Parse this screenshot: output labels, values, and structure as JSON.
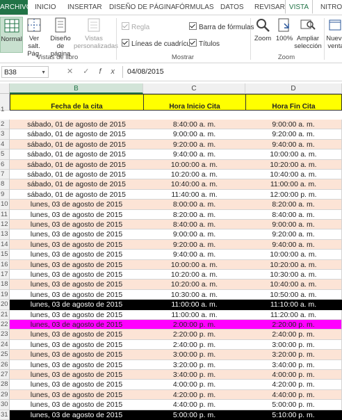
{
  "ribbon_tabs": [
    "ARCHIVO",
    "INICIO",
    "INSERTAR",
    "DISEÑO DE PÁGINA",
    "FÓRMULAS",
    "DATOS",
    "REVISAR",
    "VISTA",
    "NITRO P"
  ],
  "ribbon": {
    "normal": "Normal",
    "page_break": "Ver salt. Pág.",
    "page_layout": "Diseño de página",
    "custom_views": "Vistas personalizadas",
    "group_workbook_views": "Vistas de libro",
    "ruler": "Regla",
    "gridlines": "Líneas de cuadrícula",
    "formula_bar": "Barra de fórmulas",
    "headings": "Títulos",
    "group_show": "Mostrar",
    "zoom": "Zoom",
    "zoom_100": "100%",
    "zoom_selection": "Ampliar selección",
    "group_zoom": "Zoom",
    "new_window": "Nueva venta"
  },
  "formula_bar": {
    "name_box": "B38",
    "content": "04/08/2015"
  },
  "columns": [
    "B",
    "C",
    "D"
  ],
  "headers": [
    "Fecha de la cita",
    "Hora Inicio Cita",
    "Hora Fin Cita"
  ],
  "rows": [
    {
      "n": "2",
      "date": "sábado, 01 de agosto de 2015",
      "start": "8:40:00 a. m.",
      "end": "9:00:00 a. m.",
      "style": "peach"
    },
    {
      "n": "3",
      "date": "sábado, 01 de agosto de 2015",
      "start": "9:00:00 a. m.",
      "end": "9:20:00 a. m.",
      "style": "white"
    },
    {
      "n": "4",
      "date": "sábado, 01 de agosto de 2015",
      "start": "9:20:00 a. m.",
      "end": "9:40:00 a. m.",
      "style": "peach"
    },
    {
      "n": "5",
      "date": "sábado, 01 de agosto de 2015",
      "start": "9:40:00 a. m.",
      "end": "10:00:00 a. m.",
      "style": "white"
    },
    {
      "n": "6",
      "date": "sábado, 01 de agosto de 2015",
      "start": "10:00:00 a. m.",
      "end": "10:20:00 a. m.",
      "style": "peach"
    },
    {
      "n": "7",
      "date": "sábado, 01 de agosto de 2015",
      "start": "10:20:00 a. m.",
      "end": "10:40:00 a. m.",
      "style": "white"
    },
    {
      "n": "8",
      "date": "sábado, 01 de agosto de 2015",
      "start": "10:40:00 a. m.",
      "end": "11:00:00 a. m.",
      "style": "peach"
    },
    {
      "n": "9",
      "date": "sábado, 01 de agosto de 2015",
      "start": "11:40:00 a. m.",
      "end": "12:00:00 p. m.",
      "style": "white"
    },
    {
      "n": "10",
      "date": "lunes, 03 de agosto de 2015",
      "start": "8:00:00 a. m.",
      "end": "8:20:00 a. m.",
      "style": "peach"
    },
    {
      "n": "11",
      "date": "lunes, 03 de agosto de 2015",
      "start": "8:20:00 a. m.",
      "end": "8:40:00 a. m.",
      "style": "white"
    },
    {
      "n": "12",
      "date": "lunes, 03 de agosto de 2015",
      "start": "8:40:00 a. m.",
      "end": "9:00:00 a. m.",
      "style": "peach"
    },
    {
      "n": "13",
      "date": "lunes, 03 de agosto de 2015",
      "start": "9:00:00 a. m.",
      "end": "9:20:00 a. m.",
      "style": "white"
    },
    {
      "n": "14",
      "date": "lunes, 03 de agosto de 2015",
      "start": "9:20:00 a. m.",
      "end": "9:40:00 a. m.",
      "style": "peach"
    },
    {
      "n": "15",
      "date": "lunes, 03 de agosto de 2015",
      "start": "9:40:00 a. m.",
      "end": "10:00:00 a. m.",
      "style": "white"
    },
    {
      "n": "16",
      "date": "lunes, 03 de agosto de 2015",
      "start": "10:00:00 a. m.",
      "end": "10:20:00 a. m.",
      "style": "peach"
    },
    {
      "n": "17",
      "date": "lunes, 03 de agosto de 2015",
      "start": "10:20:00 a. m.",
      "end": "10:30:00 a. m.",
      "style": "white"
    },
    {
      "n": "18",
      "date": "lunes, 03 de agosto de 2015",
      "start": "10:20:00 a. m.",
      "end": "10:40:00 a. m.",
      "style": "peach"
    },
    {
      "n": "19",
      "date": "lunes, 03 de agosto de 2015",
      "start": "10:30:00 a. m.",
      "end": "10:50:00 a. m.",
      "style": "white"
    },
    {
      "n": "20",
      "date": "lunes, 03 de agosto de 2015",
      "start": "11:00:00 a. m.",
      "end": "11:10:00 a. m.",
      "style": "black"
    },
    {
      "n": "21",
      "date": "lunes, 03 de agosto de 2015",
      "start": "11:00:00 a. m.",
      "end": "11:20:00 a. m.",
      "style": "white"
    },
    {
      "n": "22",
      "date": "lunes, 03 de agosto de 2015",
      "start": "2:00:00 p. m.",
      "end": "2:20:00 p. m.",
      "style": "magenta"
    },
    {
      "n": "23",
      "date": "lunes, 03 de agosto de 2015",
      "start": "2:20:00 p. m.",
      "end": "2:40:00 p. m.",
      "style": "peach"
    },
    {
      "n": "24",
      "date": "lunes, 03 de agosto de 2015",
      "start": "2:40:00 p. m.",
      "end": "3:00:00 p. m.",
      "style": "white"
    },
    {
      "n": "25",
      "date": "lunes, 03 de agosto de 2015",
      "start": "3:00:00 p. m.",
      "end": "3:20:00 p. m.",
      "style": "peach"
    },
    {
      "n": "26",
      "date": "lunes, 03 de agosto de 2015",
      "start": "3:20:00 p. m.",
      "end": "3:40:00 p. m.",
      "style": "white"
    },
    {
      "n": "27",
      "date": "lunes, 03 de agosto de 2015",
      "start": "3:40:00 p. m.",
      "end": "4:00:00 p. m.",
      "style": "peach"
    },
    {
      "n": "28",
      "date": "lunes, 03 de agosto de 2015",
      "start": "4:00:00 p. m.",
      "end": "4:20:00 p. m.",
      "style": "white"
    },
    {
      "n": "29",
      "date": "lunes, 03 de agosto de 2015",
      "start": "4:20:00 p. m.",
      "end": "4:40:00 p. m.",
      "style": "peach"
    },
    {
      "n": "30",
      "date": "lunes, 03 de agosto de 2015",
      "start": "4:40:00 p. m.",
      "end": "5:00:00 p. m.",
      "style": "white"
    },
    {
      "n": "31",
      "date": "lunes, 03 de agosto de 2015",
      "start": "5:00:00 p. m.",
      "end": "5:10:00 p. m.",
      "style": "black"
    }
  ],
  "colors": {
    "accent": "#217346",
    "header_fill": "#ffff00",
    "peach": "#fce4d6",
    "white": "#ffffff",
    "black": "#000000",
    "magenta": "#ff00ff"
  }
}
